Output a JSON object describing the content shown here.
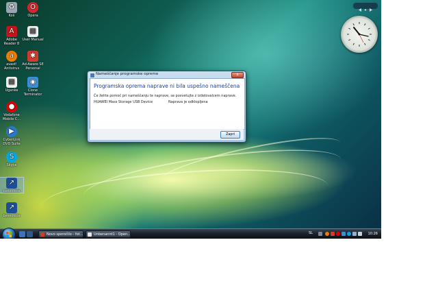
{
  "desktop": {
    "icons": [
      {
        "label": "Koš",
        "icon": "recycle-bin-icon",
        "color": "#9aa6b3"
      },
      {
        "label": "Opera",
        "icon": "opera-icon",
        "color": "#d8262b"
      },
      {
        "label": "Adobe Reader 8",
        "icon": "adobe-reader-icon",
        "color": "#c4151b"
      },
      {
        "label": "User Manual",
        "icon": "document-icon",
        "color": "#f2f2f2"
      },
      {
        "label": "avast! Antivirus",
        "icon": "avast-icon",
        "color": "#f07d00"
      },
      {
        "label": "Ad-Aware SE Personal",
        "icon": "ad-aware-icon",
        "color": "#d23b2e"
      },
      {
        "label": "Uganke",
        "icon": "document-icon",
        "color": "#f2f2f2"
      },
      {
        "label": "Clone Terminator",
        "icon": "clone-terminator-icon",
        "color": "#3b8fd6"
      },
      {
        "label": "Vodafone Mobile C...",
        "icon": "vodafone-icon",
        "color": "#e40000"
      },
      {
        "label": "CyberLink DVD Suite",
        "icon": "cyberlink-icon",
        "color": "#2a78c8"
      },
      {
        "label": "Skype",
        "icon": "skype-icon",
        "color": "#00a8e6"
      },
      {
        "label": "besedišče",
        "icon": "shortcut-icon",
        "color": "#1e4f96"
      },
      {
        "label": "besedišče",
        "icon": "shortcut-icon",
        "color": "#1e4f96"
      }
    ]
  },
  "dialog": {
    "title": "Nameščanje programske opreme",
    "close_glyph": "x",
    "heading": "Programska oprema naprave ni bila uspešno nameščena",
    "message": "Če želite pomoč pri nameščanju te naprave, se posvetujte z izdelovalcem naprave.",
    "device_name": "HUAWEI Mass Storage USB Device",
    "device_status": "Naprava je odklopljena",
    "close_button": "Zapri"
  },
  "taskbar": {
    "buttons": [
      {
        "label": "Novo sporočilo - fot...",
        "color": "#d04020"
      },
      {
        "label": "Unbenannt1 - Open...",
        "color": "#e8e8e8"
      }
    ],
    "tray": {
      "language": "SL",
      "clock": "10:26"
    }
  },
  "colors": {
    "dialog_heading": "#1a3f9e",
    "taskbar": "#1b222c"
  }
}
